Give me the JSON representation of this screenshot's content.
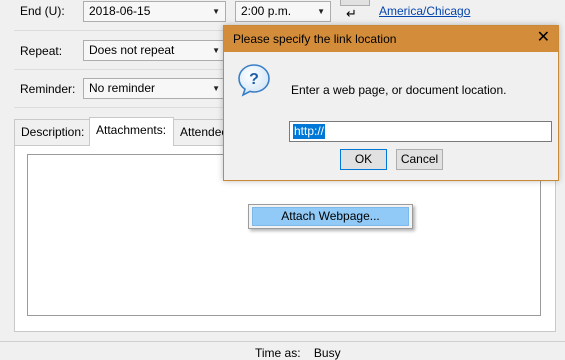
{
  "form": {
    "end_label": "End (U):",
    "end_date": "2018-06-15",
    "end_time": "2:00 p.m.",
    "timezone_link": "America/Chicago",
    "repeat_label": "Repeat:",
    "repeat_value": "Does not repeat",
    "reminder_label": "Reminder:",
    "reminder_value": "No reminder"
  },
  "tabs": [
    {
      "label": "Description:"
    },
    {
      "label": "Attachments:"
    },
    {
      "label": "Attendees"
    }
  ],
  "context_menu": {
    "item": "Attach Webpage..."
  },
  "dialog": {
    "title": "Please specify the link location",
    "message": "Enter a web page, or document location.",
    "input_value": "http://",
    "ok_label": "OK",
    "cancel_label": "Cancel",
    "title_color": "#d38c3a"
  },
  "status": {
    "time_as_label": "Time as:",
    "time_as_value": "Busy"
  }
}
